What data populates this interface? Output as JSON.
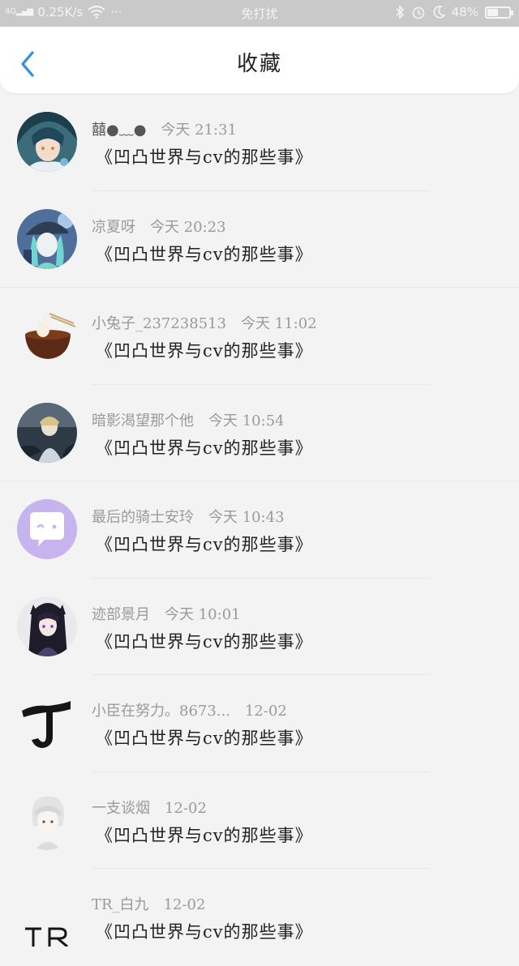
{
  "status_bar": {
    "signal": "4G",
    "speed": "0.25K/s",
    "dots": "···",
    "mode": "免打扰",
    "battery": "48%"
  },
  "header": {
    "title": "收藏",
    "back_icon": "chevron-left-icon"
  },
  "colors": {
    "accent": "#2f8fe0",
    "background": "#f3f3f3"
  },
  "favorites": [
    {
      "user": "囍●﹏●",
      "time": "今天 21:31",
      "post": "《凹凸世界与cv的那些事》"
    },
    {
      "user": "凉夏呀",
      "time": "今天 20:23",
      "post": "《凹凸世界与cv的那些事》"
    },
    {
      "user": "小兔子_237238513",
      "time": "今天 11:02",
      "post": "《凹凸世界与cv的那些事》"
    },
    {
      "user": "暗影渴望那个他",
      "time": "今天 10:54",
      "post": "《凹凸世界与cv的那些事》"
    },
    {
      "user": "最后的骑士安玲",
      "time": "今天 10:43",
      "post": "《凹凸世界与cv的那些事》"
    },
    {
      "user": "迹部景月",
      "time": "今天 10:01",
      "post": "《凹凸世界与cv的那些事》"
    },
    {
      "user": "小臣在努力。8673...",
      "time": "12-02",
      "post": "《凹凸世界与cv的那些事》"
    },
    {
      "user": "一支谈烟",
      "time": "12-02",
      "post": "《凹凸世界与cv的那些事》"
    },
    {
      "user": "TR_白九",
      "time": "12-02",
      "post": "《凹凸世界与cv的那些事》"
    }
  ]
}
